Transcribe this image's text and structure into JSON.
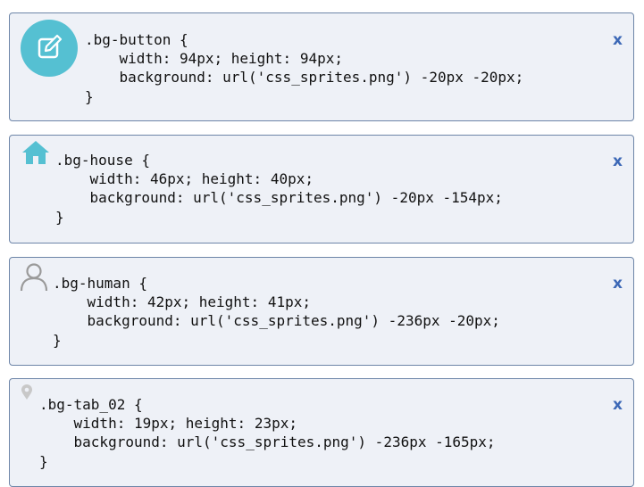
{
  "cards": [
    {
      "selector": ".bg-button {",
      "prop1": "width: 94px; height: 94px;",
      "prop2": "background: url('css_sprites.png') -20px -20px;",
      "brace": "}",
      "close": "x",
      "icon": "edit-pencil-icon",
      "icon_color": "#55c0d2"
    },
    {
      "selector": ".bg-house {",
      "prop1": "width: 46px; height: 40px;",
      "prop2": "background: url('css_sprites.png') -20px -154px;",
      "brace": "}",
      "close": "x",
      "icon": "house-icon",
      "icon_color": "#55c0d2"
    },
    {
      "selector": ".bg-human {",
      "prop1": "width: 42px; height: 41px;",
      "prop2": "background: url('css_sprites.png') -236px -20px;",
      "brace": "}",
      "close": "x",
      "icon": "human-icon",
      "icon_color": "#9a9a9a"
    },
    {
      "selector": ".bg-tab_02 {",
      "prop1": "width: 19px; height: 23px;",
      "prop2": "background: url('css_sprites.png') -236px -165px;",
      "brace": "}",
      "close": "x",
      "icon": "location-pin-icon",
      "icon_color": "#c8c8c8"
    }
  ]
}
